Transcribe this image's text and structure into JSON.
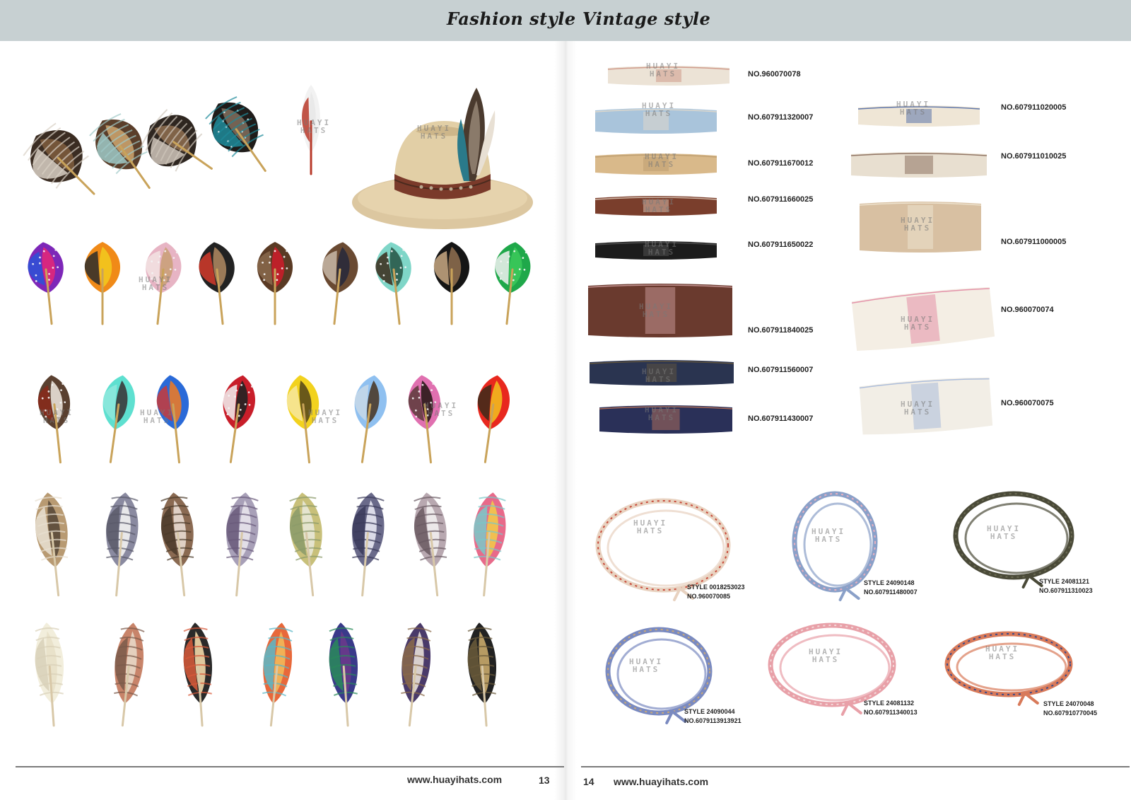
{
  "header": {
    "left_title": "Fashion style",
    "right_title": "Vintage style"
  },
  "footer": {
    "left_url": "www.huayihats.com",
    "left_page": "13",
    "right_page": "14",
    "right_url": "www.huayihats.com"
  },
  "watermark": {
    "line1": "HUAYI",
    "line2": "HATS"
  },
  "colors": {
    "header_bg": "#c7d0d2",
    "footer_rule": "#7b7b7b"
  },
  "feathers_row1": [
    {
      "palette": [
        "#3a2c22",
        "#7b5a3c",
        "#d9d0c4"
      ]
    },
    {
      "palette": [
        "#5a3e2a",
        "#c8a06a",
        "#9fc9c7"
      ]
    },
    {
      "palette": [
        "#2e2620",
        "#8a6a4c",
        "#cfc6bb"
      ]
    },
    {
      "palette": [
        "#1f1c1a",
        "#7c6a5a",
        "#1e8a9a"
      ]
    },
    {
      "palette": [
        "#f2f2f2",
        "#e8e8e8",
        "#b83a2a"
      ]
    }
  ],
  "feathers_row2": [
    {
      "palette": [
        "#7d27b8",
        "#e0287a",
        "#2c52d6"
      ]
    },
    {
      "palette": [
        "#f08a18",
        "#f2c71e",
        "#2b2b2b"
      ]
    },
    {
      "palette": [
        "#e7b4c4",
        "#caa07a",
        "#f2e3e3"
      ]
    },
    {
      "palette": [
        "#222222",
        "#a8845e",
        "#d23a2a"
      ]
    },
    {
      "palette": [
        "#5a3a24",
        "#c81e2a",
        "#8a6a4c"
      ]
    },
    {
      "palette": [
        "#6a4a32",
        "#2a2a3a",
        "#c8b8a8"
      ]
    },
    {
      "palette": [
        "#7fd6c8",
        "#2a5a4a",
        "#3a2a1a"
      ]
    },
    {
      "palette": [
        "#151515",
        "#8a6a4c",
        "#c8a882"
      ]
    },
    {
      "palette": [
        "#1fa84a",
        "#3ac85a",
        "#f2f2f2"
      ]
    }
  ],
  "feathers_row3": [
    {
      "palette": [
        "#5a4030",
        "#e8e0d8",
        "#8a2a1a"
      ]
    },
    {
      "palette": [
        "#5ee0d0",
        "#3a3a3a",
        "#8fe8dd"
      ]
    },
    {
      "palette": [
        "#2a6ad8",
        "#e87a2a",
        "#c83a3a"
      ]
    },
    {
      "palette": [
        "#c81e2a",
        "#222222",
        "#f2f2f2"
      ]
    },
    {
      "palette": [
        "#f2d21e",
        "#5a4a1a",
        "#f7e8a0"
      ]
    },
    {
      "palette": [
        "#8fc0f0",
        "#4a3a2a",
        "#c8d8e8"
      ]
    },
    {
      "palette": [
        "#e070b0",
        "#2a1a1a",
        "#5a3a3a"
      ]
    },
    {
      "palette": [
        "#e8281e",
        "#f2b81e",
        "#3a2a1a"
      ]
    }
  ],
  "feathers_row4": [
    {
      "palette": [
        "#b89a72",
        "#5a4a3a",
        "#e8e0d2"
      ]
    },
    {
      "palette": [
        "#8a8aa0",
        "#f2f2f2",
        "#5a5a6a"
      ]
    },
    {
      "palette": [
        "#8a6a52",
        "#e8dcd2",
        "#4a3a2a"
      ]
    },
    {
      "palette": [
        "#a8a0b8",
        "#e8e4ec",
        "#6a5a7a"
      ]
    },
    {
      "palette": [
        "#c8c07a",
        "#e8e8d8",
        "#8a9a6a"
      ]
    },
    {
      "palette": [
        "#6a6a8a",
        "#e8e8f2",
        "#3a3a5a"
      ]
    },
    {
      "palette": [
        "#b8a8b0",
        "#f2eef0",
        "#6a5a62"
      ]
    },
    {
      "palette": [
        "#e86a8a",
        "#f2c84a",
        "#7ac8c8"
      ]
    }
  ],
  "feathers_row5": [
    {
      "palette": [
        "#f2eedc",
        "#e8e0c8",
        "#d8d0b8"
      ]
    },
    {
      "palette": [
        "#c8846a",
        "#e8d8c8",
        "#7a5a4a"
      ]
    },
    {
      "palette": [
        "#2a2a2a",
        "#f2d8a8",
        "#d85a3a"
      ]
    },
    {
      "palette": [
        "#e8683a",
        "#f2b85a",
        "#5ab8c8"
      ]
    },
    {
      "palette": [
        "#3a3a8a",
        "#6a3a8a",
        "#2a8a5a"
      ]
    },
    {
      "palette": [
        "#4a3a6a",
        "#e8e0d8",
        "#8a6a4a"
      ]
    },
    {
      "palette": [
        "#222222",
        "#c8a86a",
        "#6a5a3a"
      ]
    }
  ],
  "bands": [
    {
      "no": "NO.960070078"
    },
    {
      "no": "NO.607911320007"
    },
    {
      "no": "NO.607911670012"
    },
    {
      "no": "NO.607911660025"
    },
    {
      "no": "NO.607911650022"
    },
    {
      "no": "NO.607911840025"
    },
    {
      "no": "NO.607911560007"
    },
    {
      "no": "NO.607911430007"
    },
    {
      "no": "NO.607911020005"
    },
    {
      "no": "NO.607911010025"
    },
    {
      "no": "NO.607911000005"
    },
    {
      "no": "NO.960070074"
    },
    {
      "no": "NO.960070075"
    }
  ],
  "cords": [
    {
      "style": "STYLE 0018253023",
      "no": "NO.960070085"
    },
    {
      "style": "STYLE 24090148",
      "no": "NO.607911480007"
    },
    {
      "style": "STYLE 24081121",
      "no": "NO.607911310023"
    },
    {
      "style": "STYLE 24090044",
      "no": "NO.6079113913921"
    },
    {
      "style": "STYLE 24081132",
      "no": "NO.607911340013"
    },
    {
      "style": "STYLE 24070048",
      "no": "NO.607910770045"
    }
  ]
}
